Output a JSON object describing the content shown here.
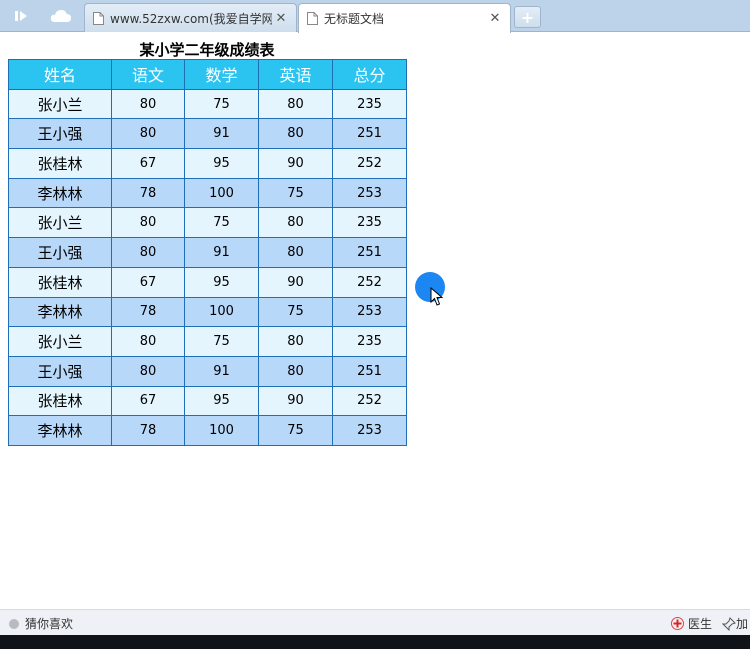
{
  "browser": {
    "tabs": [
      {
        "title": "www.52zxw.com(我爱自学网",
        "active": false
      },
      {
        "title": "无标题文档",
        "active": true
      }
    ],
    "close_glyph": "✕",
    "new_tab_glyph": "+"
  },
  "page": {
    "caption": "某小学二年级成绩表",
    "columns": [
      "姓名",
      "语文",
      "数学",
      "英语",
      "总分"
    ],
    "rows": [
      [
        "张小兰",
        "80",
        "75",
        "80",
        "235"
      ],
      [
        "王小强",
        "80",
        "91",
        "80",
        "251"
      ],
      [
        "张桂林",
        "67",
        "95",
        "90",
        "252"
      ],
      [
        "李林林",
        "78",
        "100",
        "75",
        "253"
      ],
      [
        "张小兰",
        "80",
        "75",
        "80",
        "235"
      ],
      [
        "王小强",
        "80",
        "91",
        "80",
        "251"
      ],
      [
        "张桂林",
        "67",
        "95",
        "90",
        "252"
      ],
      [
        "李林林",
        "78",
        "100",
        "75",
        "253"
      ],
      [
        "张小兰",
        "80",
        "75",
        "80",
        "235"
      ],
      [
        "王小强",
        "80",
        "91",
        "80",
        "251"
      ],
      [
        "张桂林",
        "67",
        "95",
        "90",
        "252"
      ],
      [
        "李林林",
        "78",
        "100",
        "75",
        "253"
      ]
    ],
    "colors": {
      "header": "#2bc4f1",
      "row_light": "#e4f5fd",
      "row_dark": "#b8d8fa",
      "border": "#1e6fb8"
    }
  },
  "statusbar": {
    "left_label": "猜你喜欢",
    "doctor_label": "医生",
    "right_extra": "加"
  }
}
